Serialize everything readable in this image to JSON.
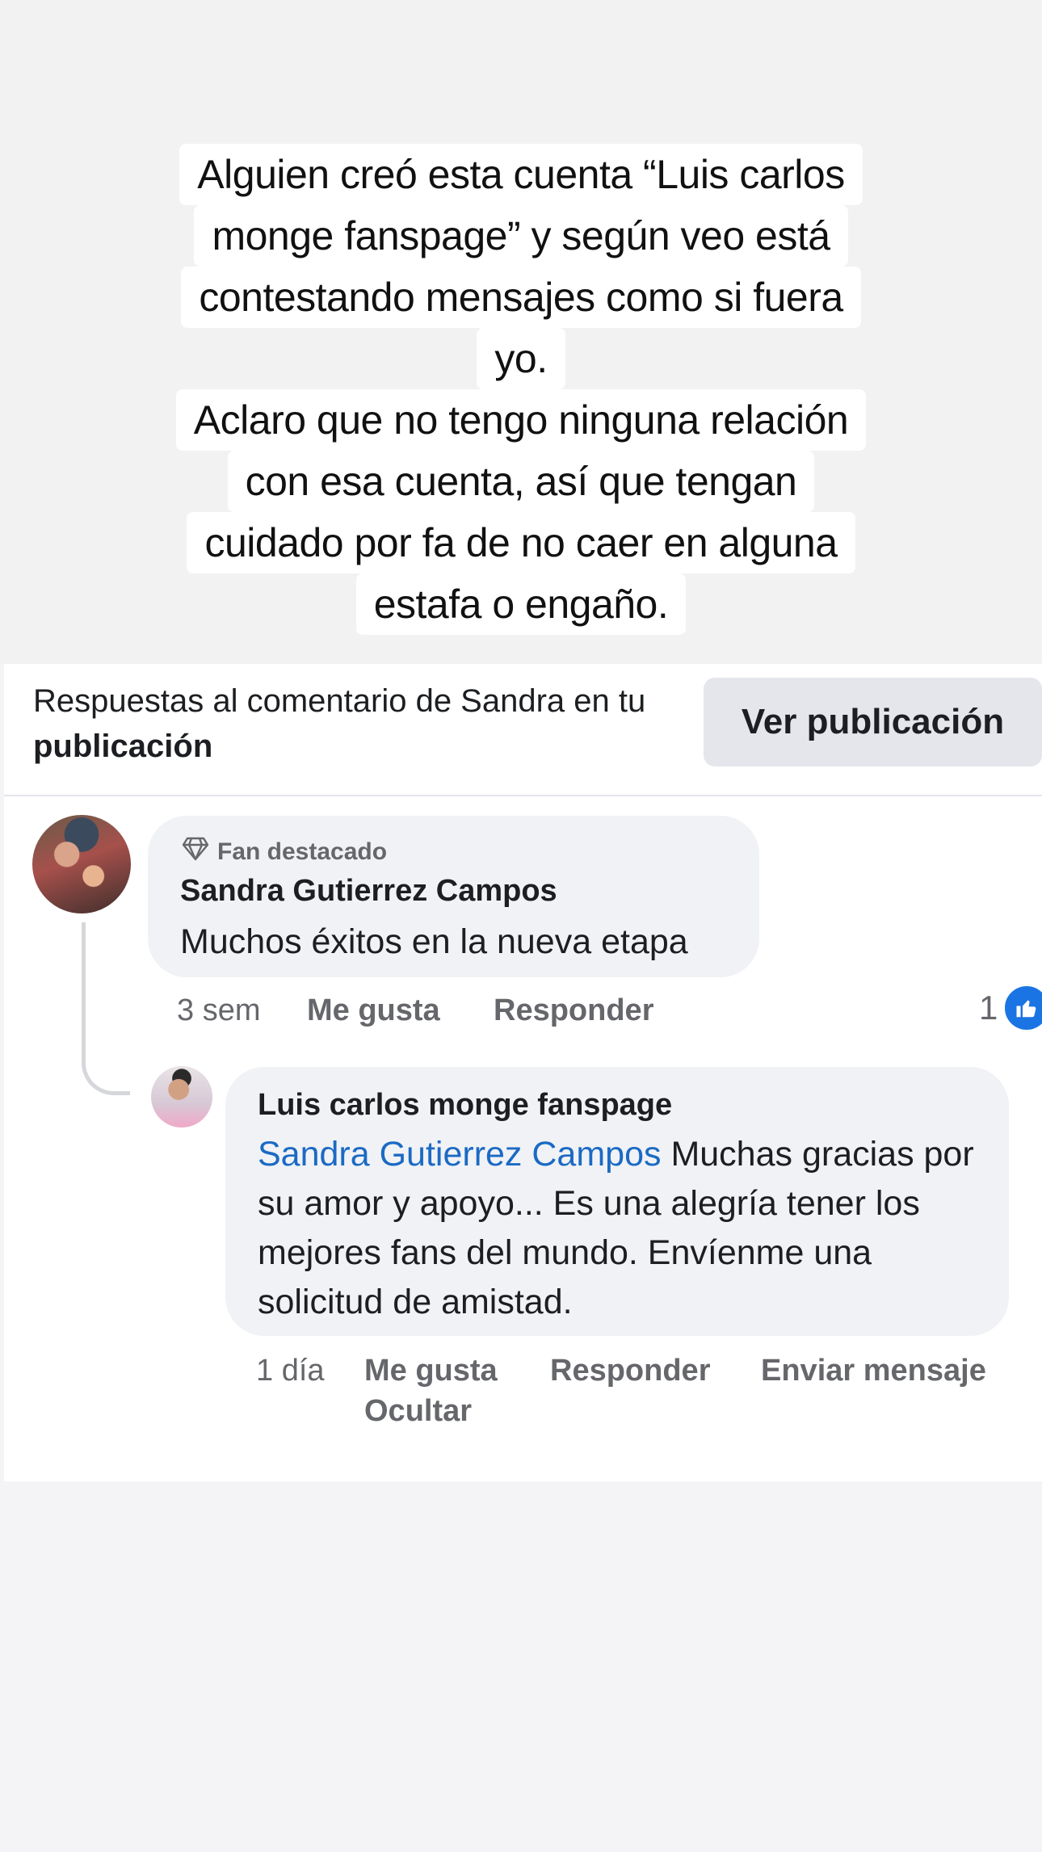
{
  "story": {
    "lines": [
      "Alguien creó esta cuenta “Luis carlos",
      "monge fanspage” y según veo está",
      "contestando  mensajes como si fuera",
      "yo.",
      "Aclaro que no tengo ninguna relación",
      "con esa cuenta, así que tengan",
      "cuidado por fa de no caer en alguna",
      "estafa o engaño."
    ]
  },
  "header": {
    "text_prefix": "Respuestas al comentario de Sandra en tu ",
    "text_bold": "publicación",
    "view_button": "Ver publicación"
  },
  "comment1": {
    "badge": "Fan destacado",
    "author": "Sandra Gutierrez Campos",
    "text": "Muchos éxitos en la nueva etapa",
    "time": "3 sem",
    "like": "Me gusta",
    "reply": "Responder",
    "reaction_count": "1"
  },
  "comment2": {
    "author": "Luis carlos monge fanspage",
    "mention": "Sandra Gutierrez Campos",
    "text": " Muchas gracias por su amor y apoyo... Es una alegría tener los mejores fans del mundo. Envíenme una solicitud de amistad.",
    "time": "1 día",
    "like": "Me gusta",
    "reply": "Responder",
    "message": "Enviar mensaje",
    "hide": "Ocultar"
  },
  "colors": {
    "link": "#1b6ac4",
    "like_blue": "#1b74e4",
    "bubble": "#f0f2f5"
  }
}
